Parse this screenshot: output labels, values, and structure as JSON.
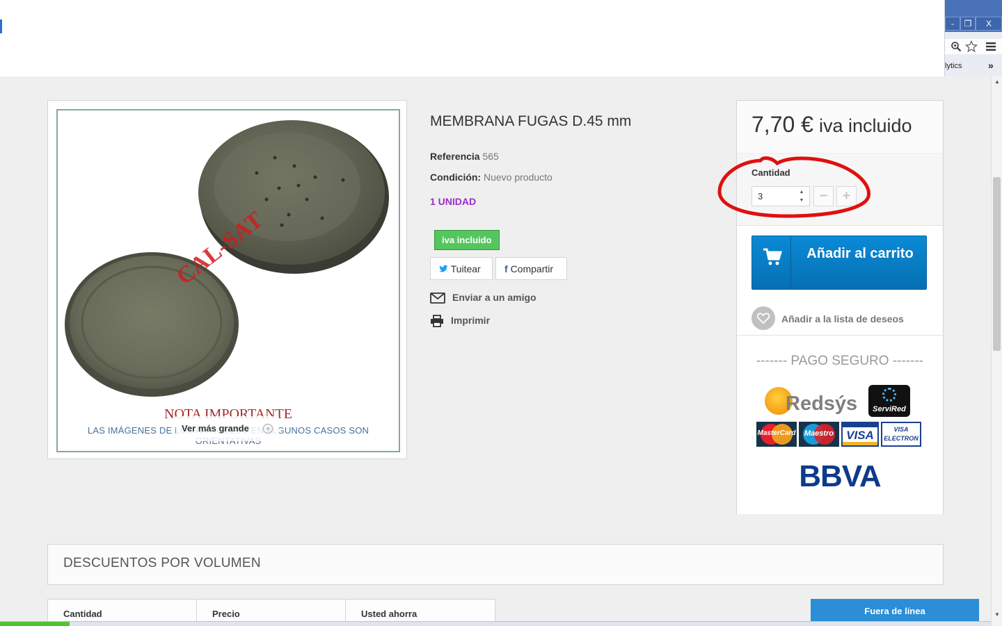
{
  "browser": {
    "analytics_label": "lytics",
    "window_buttons": [
      "-",
      "❐",
      "X"
    ]
  },
  "product": {
    "title": "MEMBRANA FUGAS D.45 mm",
    "reference_label": "Referencia",
    "reference_value": "565",
    "condition_label": "Condición:",
    "condition_value": "Nuevo producto",
    "unit": "1 UNIDAD",
    "tax_badge": "iva incluido",
    "tweet_label": "Tuitear",
    "share_label": "Compartir",
    "send_friend": "Enviar a un amigo",
    "print": "Imprimir",
    "image": {
      "watermark": "CAL-SAT",
      "note_title": "NOTA IMPORTANTE",
      "disclaimer": "LAS IMÁGENES DE LOS ARTÍCULOS EN ALGUNOS CASOS SON ORIENTATIVAS",
      "zoom_label": "Ver más grande"
    }
  },
  "buy": {
    "price": "7,70 €",
    "price_note": "iva incluido",
    "quantity_label": "Cantidad",
    "quantity_value": "3",
    "add_to_cart": "Añadir al carrito",
    "wishlist": "Añadir a la lista de deseos",
    "secure_payment": "------- PAGO SEGURO -------",
    "payment_logos": [
      "Redsýs",
      "ServiRed",
      "MasterCard",
      "Maestro",
      "VISA",
      "VISA ELECTRON",
      "BBVA"
    ]
  },
  "discounts": {
    "title": "DESCUENTOS POR VOLUMEN",
    "columns": [
      "Cantidad",
      "Precio",
      "Usted ahorra"
    ]
  },
  "chat": {
    "label": "Fuera de línea"
  },
  "colors": {
    "cart_button": "#0a8ad6",
    "badge_green": "#55c65e",
    "unit_purple": "#9b2dc7",
    "annotation_red": "#e01010"
  }
}
